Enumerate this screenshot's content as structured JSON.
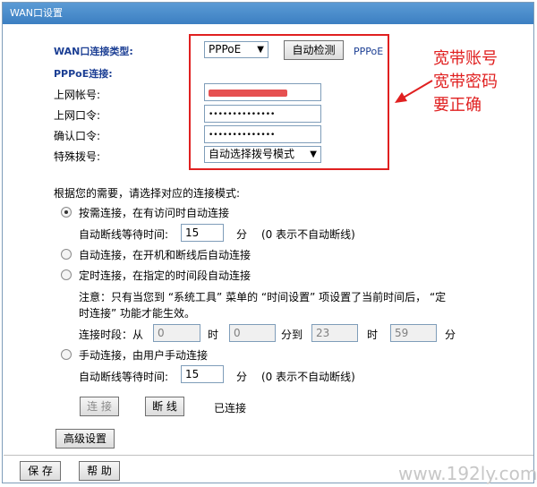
{
  "titlebar": {
    "title": "WAN口设置"
  },
  "wan": {
    "type_label": "WAN口连接类型:",
    "type_value": "PPPoE",
    "detect_button": "自动检测",
    "detect_result": "PPPoE",
    "pppoe_section": "PPPoE连接:",
    "account_label": "上网帐号:",
    "password_label": "上网口令:",
    "password_mask": "••••••••••••••",
    "confirm_label": "确认口令:",
    "confirm_mask": "••••••••••••••",
    "dial_label": "特殊拨号:",
    "dial_value": "自动选择拨号模式"
  },
  "annotation": {
    "line1": "宽带账号",
    "line2": "宽带密码",
    "line3": "要正确"
  },
  "modes": {
    "prompt": "根据您的需要，请选择对应的连接模式:",
    "on_demand": "按需连接，在有访问时自动连接",
    "idle_label": "自动断线等待时间:",
    "idle_value": "15",
    "idle_unit": "分",
    "idle_note": "(0 表示不自动断线)",
    "auto": "自动连接，在开机和断线后自动连接",
    "timed": "定时连接，在指定的时间段自动连接",
    "timed_note_1": "注意：只有当您到 “系统工具” 菜单的 “时间设置” 项设置了当前时间后， “定",
    "timed_note_2": "时连接” 功能才能生效。",
    "period_label": "连接时段：从",
    "from_hour": "0",
    "hour_unit": "时",
    "from_min": "0",
    "to_label": "分到",
    "to_hour": "23",
    "to_min": "59",
    "min_unit": "分",
    "manual": "手动连接，由用户手动连接",
    "manual_idle_label": "自动断线等待时间:",
    "manual_idle_value": "15",
    "manual_idle_unit": "分",
    "manual_idle_note": "(0 表示不自动断线)"
  },
  "actions": {
    "connect": "连 接",
    "disconnect": "断 线",
    "status": "已连接",
    "advanced": "高级设置",
    "save": "保 存",
    "help": "帮 助"
  },
  "watermark": "www.192ly.com",
  "colors": {
    "titlebar": "#3c7fc2",
    "highlight_box": "#e02020",
    "label_blue": "#1c3f94"
  }
}
